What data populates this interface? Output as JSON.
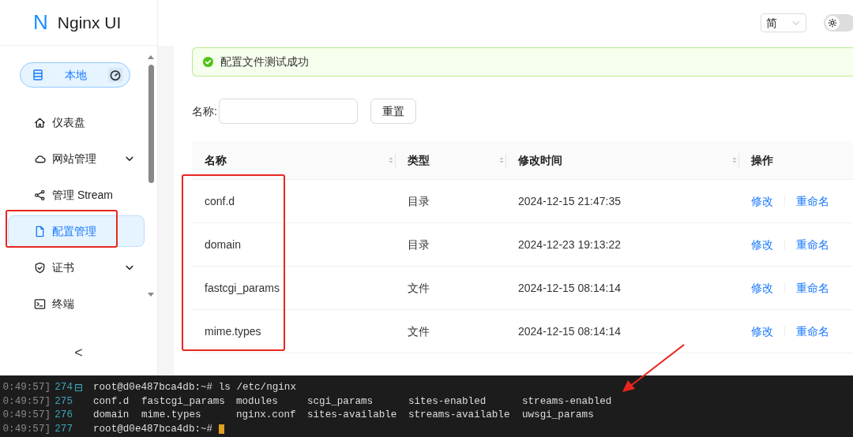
{
  "sidebar": {
    "logo_letter": "N",
    "title": "Nginx UI",
    "node": {
      "label": "本地"
    },
    "items": [
      {
        "label": "仪表盘",
        "kind": "home",
        "selected": false,
        "has_children": false,
        "annotated": false
      },
      {
        "label": "网站管理",
        "kind": "cloud",
        "selected": false,
        "has_children": true,
        "annotated": false
      },
      {
        "label": "管理 Stream",
        "kind": "share",
        "selected": false,
        "has_children": false,
        "annotated": false
      },
      {
        "label": "配置管理",
        "kind": "file",
        "selected": true,
        "has_children": false,
        "annotated": true
      },
      {
        "label": "证书",
        "kind": "shield",
        "selected": false,
        "has_children": true,
        "annotated": false
      },
      {
        "label": "终端",
        "kind": "terminal",
        "selected": false,
        "has_children": false,
        "annotated": false
      }
    ],
    "collapse": "<"
  },
  "header": {
    "language": "简",
    "dark_mode": false
  },
  "alert": {
    "message": "配置文件测试成功"
  },
  "filter": {
    "label": "名称:",
    "reset": "重置"
  },
  "table": {
    "columns": [
      {
        "title": "名称",
        "sortable": true
      },
      {
        "title": "类型",
        "sortable": true
      },
      {
        "title": "修改时间",
        "sortable": true
      },
      {
        "title": "操作",
        "sortable": false
      }
    ],
    "name_column_annotated": true,
    "rows": [
      {
        "name": "conf.d",
        "type": "目录",
        "modified": "2024-12-15 21:47:35",
        "actions": [
          "修改",
          "重命名"
        ]
      },
      {
        "name": "domain",
        "type": "目录",
        "modified": "2024-12-23 19:13:22",
        "actions": [
          "修改",
          "重命名"
        ]
      },
      {
        "name": "fastcgi_params",
        "type": "文件",
        "modified": "2024-12-15 08:14:14",
        "actions": [
          "修改",
          "重命名"
        ]
      },
      {
        "name": "mime.types",
        "type": "文件",
        "modified": "2024-12-15 08:14:14",
        "actions": [
          "修改",
          "重命名"
        ]
      }
    ]
  },
  "terminal": {
    "arrow_annotation": true,
    "lines": [
      {
        "time": "0:49:57]",
        "number": "274",
        "fold": true,
        "prompt": "root@d0e487bca4db:~#",
        "command": "ls /etc/nginx"
      },
      {
        "time": "0:49:57]",
        "number": "275",
        "fold": false,
        "columns": [
          "conf.d",
          "fastcgi_params",
          "modules",
          "scgi_params",
          "sites-enabled",
          "streams-enabled"
        ]
      },
      {
        "time": "0:49:57]",
        "number": "276",
        "fold": false,
        "columns": [
          "domain",
          "mime.types",
          "nginx.conf",
          "sites-available",
          "streams-available",
          "uwsgi_params"
        ]
      },
      {
        "time": "0:49:57]",
        "number": "277",
        "fold": false,
        "prompt": "root@d0e487bca4db:~#",
        "cursor": true
      }
    ]
  }
}
